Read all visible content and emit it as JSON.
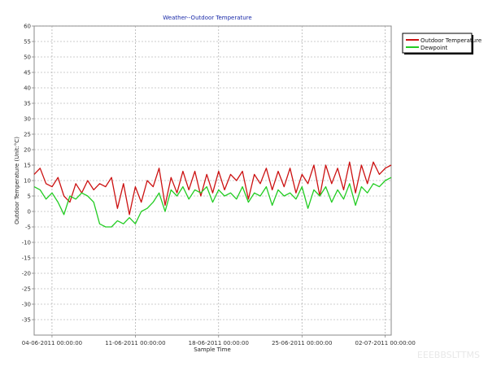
{
  "chart_data": {
    "type": "line",
    "title": "Weather--Outdoor Temperature",
    "xlabel": "Sample Time",
    "ylabel": "Outdoor Temperature (Unit:°C)",
    "ylim": [
      -40,
      60
    ],
    "yticks": [
      60,
      55,
      50,
      45,
      40,
      35,
      30,
      25,
      20,
      15,
      10,
      5,
      0,
      -5,
      -10,
      -15,
      -20,
      -25,
      -30,
      -35
    ],
    "xlim": [
      "2011-06-02 12:00:00",
      "2011-07-02 12:00:00"
    ],
    "xticks": [
      {
        "value": "2011-06-04 00:00:00",
        "label": "04-06-2011 00:00:00"
      },
      {
        "value": "2011-06-11 00:00:00",
        "label": "11-06-2011 00:00:00"
      },
      {
        "value": "2011-06-18 00:00:00",
        "label": "18-06-2011 00:00:00"
      },
      {
        "value": "2011-06-25 00:00:00",
        "label": "25-06-2011 00:00:00"
      },
      {
        "value": "2011-07-02 00:00:00",
        "label": "02-07-2011 00:00:00"
      }
    ],
    "grid": true,
    "legend_position": "top-right",
    "series": [
      {
        "name": "Outdoor Temperature",
        "color": "#cc1111",
        "x": [
          "2011-06-02 12:00:00",
          "2011-06-03 00:00:00",
          "2011-06-03 12:00:00",
          "2011-06-04 00:00:00",
          "2011-06-04 12:00:00",
          "2011-06-05 00:00:00",
          "2011-06-05 12:00:00",
          "2011-06-06 00:00:00",
          "2011-06-06 12:00:00",
          "2011-06-07 00:00:00",
          "2011-06-07 12:00:00",
          "2011-06-08 00:00:00",
          "2011-06-08 12:00:00",
          "2011-06-09 00:00:00",
          "2011-06-09 12:00:00",
          "2011-06-10 00:00:00",
          "2011-06-10 12:00:00",
          "2011-06-11 00:00:00",
          "2011-06-11 12:00:00",
          "2011-06-12 00:00:00",
          "2011-06-12 12:00:00",
          "2011-06-13 00:00:00",
          "2011-06-13 12:00:00",
          "2011-06-14 00:00:00",
          "2011-06-14 12:00:00",
          "2011-06-15 00:00:00",
          "2011-06-15 12:00:00",
          "2011-06-16 00:00:00",
          "2011-06-16 12:00:00",
          "2011-06-17 00:00:00",
          "2011-06-17 12:00:00",
          "2011-06-18 00:00:00",
          "2011-06-18 12:00:00",
          "2011-06-19 00:00:00",
          "2011-06-19 12:00:00",
          "2011-06-20 00:00:00",
          "2011-06-20 12:00:00",
          "2011-06-21 00:00:00",
          "2011-06-21 12:00:00",
          "2011-06-22 00:00:00",
          "2011-06-22 12:00:00",
          "2011-06-23 00:00:00",
          "2011-06-23 12:00:00",
          "2011-06-24 00:00:00",
          "2011-06-24 12:00:00",
          "2011-06-25 00:00:00",
          "2011-06-25 12:00:00",
          "2011-06-26 00:00:00",
          "2011-06-26 12:00:00",
          "2011-06-27 00:00:00",
          "2011-06-27 12:00:00",
          "2011-06-28 00:00:00",
          "2011-06-28 12:00:00",
          "2011-06-29 00:00:00",
          "2011-06-29 12:00:00",
          "2011-06-30 00:00:00",
          "2011-06-30 12:00:00",
          "2011-07-01 00:00:00",
          "2011-07-01 12:00:00",
          "2011-07-02 00:00:00",
          "2011-07-02 12:00:00"
        ],
        "values": [
          12,
          14,
          9,
          8,
          11,
          5,
          3,
          9,
          6,
          10,
          7,
          9,
          8,
          11,
          1,
          9,
          -1,
          8,
          3,
          10,
          8,
          14,
          2,
          11,
          6,
          13,
          7,
          13,
          5,
          12,
          6,
          13,
          7,
          12,
          10,
          13,
          4,
          12,
          9,
          14,
          7,
          13,
          8,
          14,
          6,
          12,
          9,
          15,
          5,
          15,
          9,
          14,
          7,
          16,
          6,
          15,
          9,
          16,
          12,
          14,
          15
        ]
      },
      {
        "name": "Dewpoint",
        "color": "#22cc22",
        "x": [
          "2011-06-02 12:00:00",
          "2011-06-03 00:00:00",
          "2011-06-03 12:00:00",
          "2011-06-04 00:00:00",
          "2011-06-04 12:00:00",
          "2011-06-05 00:00:00",
          "2011-06-05 12:00:00",
          "2011-06-06 00:00:00",
          "2011-06-06 12:00:00",
          "2011-06-07 00:00:00",
          "2011-06-07 12:00:00",
          "2011-06-08 00:00:00",
          "2011-06-08 12:00:00",
          "2011-06-09 00:00:00",
          "2011-06-09 12:00:00",
          "2011-06-10 00:00:00",
          "2011-06-10 12:00:00",
          "2011-06-11 00:00:00",
          "2011-06-11 12:00:00",
          "2011-06-12 00:00:00",
          "2011-06-12 12:00:00",
          "2011-06-13 00:00:00",
          "2011-06-13 12:00:00",
          "2011-06-14 00:00:00",
          "2011-06-14 12:00:00",
          "2011-06-15 00:00:00",
          "2011-06-15 12:00:00",
          "2011-06-16 00:00:00",
          "2011-06-16 12:00:00",
          "2011-06-17 00:00:00",
          "2011-06-17 12:00:00",
          "2011-06-18 00:00:00",
          "2011-06-18 12:00:00",
          "2011-06-19 00:00:00",
          "2011-06-19 12:00:00",
          "2011-06-20 00:00:00",
          "2011-06-20 12:00:00",
          "2011-06-21 00:00:00",
          "2011-06-21 12:00:00",
          "2011-06-22 00:00:00",
          "2011-06-22 12:00:00",
          "2011-06-23 00:00:00",
          "2011-06-23 12:00:00",
          "2011-06-24 00:00:00",
          "2011-06-24 12:00:00",
          "2011-06-25 00:00:00",
          "2011-06-25 12:00:00",
          "2011-06-26 00:00:00",
          "2011-06-26 12:00:00",
          "2011-06-27 00:00:00",
          "2011-06-27 12:00:00",
          "2011-06-28 00:00:00",
          "2011-06-28 12:00:00",
          "2011-06-29 00:00:00",
          "2011-06-29 12:00:00",
          "2011-06-30 00:00:00",
          "2011-06-30 12:00:00",
          "2011-07-01 00:00:00",
          "2011-07-01 12:00:00",
          "2011-07-02 00:00:00",
          "2011-07-02 12:00:00"
        ],
        "values": [
          8,
          7,
          4,
          6,
          3,
          -1,
          5,
          4,
          6,
          5,
          3,
          -4,
          -5,
          -5,
          -3,
          -4,
          -2,
          -4,
          0,
          1,
          3,
          6,
          0,
          7,
          5,
          8,
          4,
          7,
          6,
          8,
          3,
          7,
          5,
          6,
          4,
          8,
          3,
          6,
          5,
          8,
          2,
          7,
          5,
          6,
          4,
          8,
          1,
          7,
          5,
          8,
          3,
          7,
          4,
          9,
          2,
          8,
          6,
          9,
          8,
          10,
          11
        ]
      }
    ]
  },
  "watermark": "EEEBBSLTTMS"
}
